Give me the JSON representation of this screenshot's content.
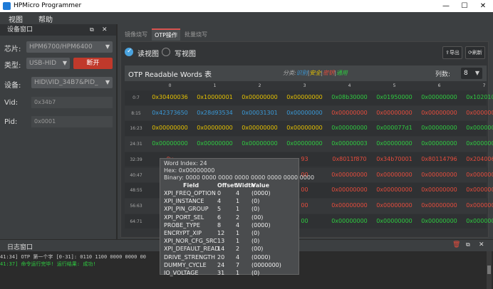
{
  "window": {
    "title": "HPMicro Programmer"
  },
  "menu": [
    "视图",
    "帮助"
  ],
  "device_panel": {
    "title": "设备窗口",
    "chip_label": "芯片:",
    "chip_value": "HPM6700/HPM6400",
    "type_label": "类型:",
    "type_value": "USB-HID",
    "disconnect_label": "断开",
    "device_label": "设备:",
    "device_value": "HID\\VID_34B7&PID_",
    "vid_label": "Vid:",
    "vid_value": "0x34b7",
    "pid_label": "Pid:",
    "pid_value": "0x0001"
  },
  "tabs": [
    "镜像烧写",
    "OTP操作",
    "批量烧写"
  ],
  "view": {
    "read_label": "读视图",
    "write_label": "写视图"
  },
  "toolbar": {
    "export_label": "导出",
    "refresh_label": "刷新"
  },
  "otp": {
    "title": "OTP Readable Words 表",
    "category_prefix": "分类:",
    "category_parts": [
      {
        "text": "识别",
        "color": "#3a9ad9"
      },
      {
        "text": "|",
        "color": "#aaaaaa"
      },
      {
        "text": "安全",
        "color": "#e6c200"
      },
      {
        "text": "|",
        "color": "#aaaaaa"
      },
      {
        "text": "密钥",
        "color": "#e74c3c"
      },
      {
        "text": "|",
        "color": "#aaaaaa"
      },
      {
        "text": "通用",
        "color": "#2ecc40"
      }
    ],
    "columns_label": "列数:",
    "columns_value": "8",
    "col_headers": [
      "0",
      "1",
      "2",
      "3",
      "4",
      "5",
      "6",
      "7"
    ],
    "rows": [
      {
        "label": "0:7",
        "cells": [
          [
            "0x30400036",
            "y"
          ],
          [
            "0x10000001",
            "y"
          ],
          [
            "0x00000000",
            "y"
          ],
          [
            "0x00000000",
            "y"
          ],
          [
            "0x08b30000",
            "g"
          ],
          [
            "0x01950000",
            "g"
          ],
          [
            "0x00000000",
            "g"
          ],
          [
            "0x10201001",
            "g"
          ]
        ]
      },
      {
        "label": "8:15",
        "cells": [
          [
            "0x42373650",
            "b"
          ],
          [
            "0x28d93534",
            "b"
          ],
          [
            "0x00031301",
            "b"
          ],
          [
            "0x00000000",
            "b"
          ],
          [
            "0x00000000",
            "r"
          ],
          [
            "0x00000000",
            "r"
          ],
          [
            "0x00000000",
            "r"
          ],
          [
            "0x00000000",
            "r"
          ]
        ]
      },
      {
        "label": "16:23",
        "cells": [
          [
            "0x00000000",
            "y"
          ],
          [
            "0x00000000",
            "y"
          ],
          [
            "0x00000000",
            "y"
          ],
          [
            "0x00000000",
            "y"
          ],
          [
            "0x00000000",
            "g"
          ],
          [
            "0x000077d1",
            "g"
          ],
          [
            "0x00000000",
            "g"
          ],
          [
            "0x00000000",
            "g"
          ]
        ]
      },
      {
        "label": "24:31",
        "cells": [
          [
            "0x00000000",
            "g"
          ],
          [
            "0x00000000",
            "g"
          ],
          [
            "0x00000000",
            "g"
          ],
          [
            "0x00000000",
            "g"
          ],
          [
            "0x00000003",
            "g"
          ],
          [
            "0x00000000",
            "g"
          ],
          [
            "0x00000000",
            "g"
          ],
          [
            "0x00000000",
            "g"
          ]
        ]
      },
      {
        "label": "32:39",
        "cells": [
          [
            "0x",
            "r"
          ],
          [
            "",
            "r"
          ],
          [
            "",
            "r"
          ],
          [
            "93",
            "r"
          ],
          [
            "0x8011f870",
            "r"
          ],
          [
            "0x34b70001",
            "r"
          ],
          [
            "0x80114796",
            "r"
          ],
          [
            "0x20400693",
            "r"
          ]
        ]
      },
      {
        "label": "40:47",
        "cells": [
          [
            "0x",
            "r"
          ],
          [
            "",
            "r"
          ],
          [
            "",
            "r"
          ],
          [
            "00",
            "r"
          ],
          [
            "0x00000000",
            "r"
          ],
          [
            "0x00000000",
            "r"
          ],
          [
            "0x00000000",
            "r"
          ],
          [
            "0x00000000",
            "r"
          ]
        ]
      },
      {
        "label": "48:55",
        "cells": [
          [
            "0x",
            "r"
          ],
          [
            "",
            "r"
          ],
          [
            "",
            "r"
          ],
          [
            "00",
            "r"
          ],
          [
            "0x00000000",
            "r"
          ],
          [
            "0x00000000",
            "r"
          ],
          [
            "0x00000000",
            "r"
          ],
          [
            "0x00000000",
            "r"
          ]
        ]
      },
      {
        "label": "56:63",
        "cells": [
          [
            "0x",
            "r"
          ],
          [
            "",
            "r"
          ],
          [
            "",
            "r"
          ],
          [
            "00",
            "r"
          ],
          [
            "0x00000000",
            "r"
          ],
          [
            "0x00000000",
            "r"
          ],
          [
            "0x00000000",
            "r"
          ],
          [
            "0x00000000",
            "r"
          ]
        ]
      },
      {
        "label": "64:71",
        "cells": [
          [
            "0x1",
            "g"
          ],
          [
            "",
            "g"
          ],
          [
            "",
            "g"
          ],
          [
            "00",
            "g"
          ],
          [
            "0x00000000",
            "g"
          ],
          [
            "0x00000000",
            "g"
          ],
          [
            "0x00000000",
            "g"
          ],
          [
            "0x00000000",
            "g"
          ]
        ]
      }
    ]
  },
  "tooltip": {
    "word_index": "Word Index: 24",
    "hex": "Hex: 0x00000000",
    "binary": "Binary: 0000 0000 0000 0000 0000 0000 0000 0000",
    "headers": [
      "Field",
      "Offset",
      "Width",
      "Value"
    ],
    "fields": [
      [
        "XPI_FREQ_OPTION",
        "0",
        "4",
        "(0000)"
      ],
      [
        "XPI_INSTANCE",
        "4",
        "1",
        "(0)"
      ],
      [
        "XPI_PIN_GROUP",
        "5",
        "1",
        "(0)"
      ],
      [
        "XPI_PORT_SEL",
        "6",
        "2",
        "(00)"
      ],
      [
        "PROBE_TYPE",
        "8",
        "4",
        "(0000)"
      ],
      [
        "ENCRYPT_XIP",
        "12",
        "1",
        "(0)"
      ],
      [
        "XPI_NOR_CFG_SRC",
        "13",
        "1",
        "(0)"
      ],
      [
        "XPI_DEFAULT_READ",
        "14",
        "2",
        "(00)"
      ],
      [
        "DRIVE_STRENGTH",
        "20",
        "4",
        "(0000)"
      ],
      [
        "DUMMY_CYCLE",
        "24",
        "7",
        "(0000000)"
      ],
      [
        "IO_VOLTAGE",
        "31",
        "1",
        "(0)"
      ]
    ]
  },
  "log": {
    "title": "日志窗口",
    "lines": [
      {
        "text": "41:34] OTP 第一个字 [0-31]: 0110 1100 0000 0000 00",
        "color": "#cccccc"
      },
      {
        "text": "41:37] 命令运行完毕! 运行结果: 成功!",
        "color": "#2ecc40"
      }
    ]
  }
}
